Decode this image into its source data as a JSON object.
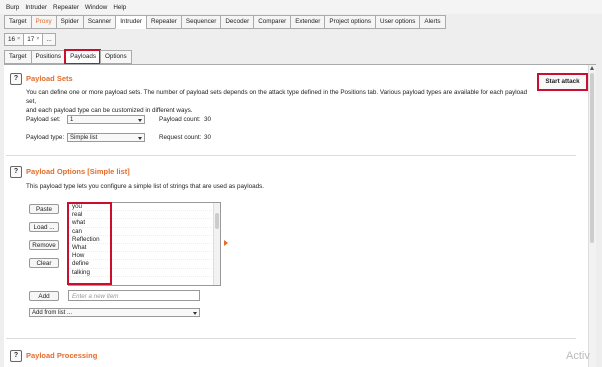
{
  "menu": [
    "Burp",
    "Intruder",
    "Repeater",
    "Window",
    "Help"
  ],
  "main_tabs": [
    "Target",
    "Proxy",
    "Spider",
    "Scanner",
    "Intruder",
    "Repeater",
    "Sequencer",
    "Decoder",
    "Comparer",
    "Extender",
    "Project options",
    "User options",
    "Alerts"
  ],
  "sub_tabs": [
    "16",
    "17",
    "..."
  ],
  "inner_tabs": [
    "Target",
    "Positions",
    "Payloads",
    "Options"
  ],
  "payload_sets": {
    "title": "Payload Sets",
    "start_button": "Start attack",
    "desc1": "You can define one or more payload sets. The number of payload sets depends on the attack type defined in the Positions tab. Various payload types are available for each payload set,",
    "desc2": "and each payload type can be customized in different ways.",
    "set_label": "Payload set:",
    "set_value": "1",
    "count_label": "Payload count:",
    "count_value": "30",
    "type_label": "Payload type:",
    "type_value": "Simple list",
    "request_label": "Request count:",
    "request_value": "30"
  },
  "payload_options": {
    "title": "Payload Options [Simple list]",
    "desc": "This payload type lets you configure a simple list of strings that are used as payloads.",
    "buttons": [
      "Paste",
      "Load ...",
      "Remove",
      "Clear"
    ],
    "items": [
      "you",
      "real",
      "what",
      "can",
      "Reflection",
      "What",
      "How",
      "define",
      "talking"
    ],
    "add_button": "Add",
    "add_placeholder": "Enter a new item",
    "add_from_list": "Add from list ..."
  },
  "payload_processing": {
    "title": "Payload Processing"
  },
  "watermark": "Activ",
  "colors": {
    "accent": "#e36c29",
    "highlight": "#c8102e"
  }
}
